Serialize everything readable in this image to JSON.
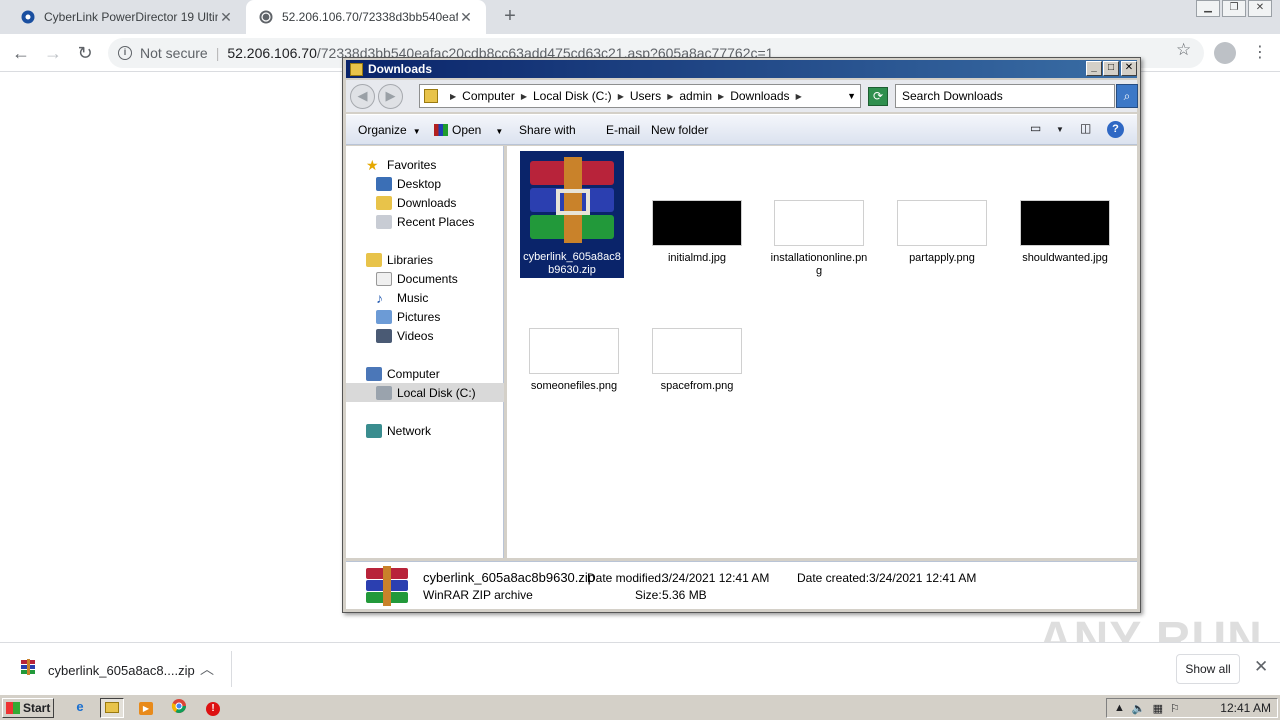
{
  "browser": {
    "tabs": [
      {
        "title": "CyberLink PowerDirector 19 Ultimate"
      },
      {
        "title": "52.206.106.70/72338d3bb540eafac"
      }
    ],
    "address": {
      "security": "Not secure",
      "host": "52.206.106.70",
      "path": "/72338d3bb540eafac20cdb8cc63add475cd63c21.asp?605a8ac77762c=1"
    }
  },
  "explorer": {
    "title": "Downloads",
    "breadcrumb": [
      "Computer",
      "Local Disk (C:)",
      "Users",
      "admin",
      "Downloads"
    ],
    "search_placeholder": "Search Downloads",
    "commands": {
      "organize": "Organize",
      "open": "Open",
      "share": "Share with",
      "email": "E-mail",
      "new_folder": "New folder"
    },
    "nav": {
      "favorites": "Favorites",
      "desktop": "Desktop",
      "downloads": "Downloads",
      "recent": "Recent Places",
      "libraries": "Libraries",
      "documents": "Documents",
      "music": "Music",
      "pictures": "Pictures",
      "videos": "Videos",
      "computer": "Computer",
      "local_disk": "Local Disk (C:)",
      "network": "Network"
    },
    "files": [
      {
        "name": "cyberlink_605a8ac8b9630.zip"
      },
      {
        "name": "initialmd.jpg"
      },
      {
        "name": "installationonline.png"
      },
      {
        "name": "partapply.png"
      },
      {
        "name": "shouldwanted.jpg"
      },
      {
        "name": "someonefiles.png"
      },
      {
        "name": "spacefrom.png"
      }
    ],
    "details": {
      "name": "cyberlink_605a8ac8b9630.zip",
      "type": "WinRAR ZIP archive",
      "modified_label": "Date modified:",
      "modified": "3/24/2021 12:41 AM",
      "created_label": "Date created:",
      "created": "3/24/2021 12:41 AM",
      "size_label": "Size:",
      "size": "5.36 MB"
    }
  },
  "download_shelf": {
    "filename": "cyberlink_605a8ac8....zip",
    "show_all": "Show all"
  },
  "watermark": "ANY RUN",
  "taskbar": {
    "start": "Start",
    "clock": "12:41 AM"
  }
}
